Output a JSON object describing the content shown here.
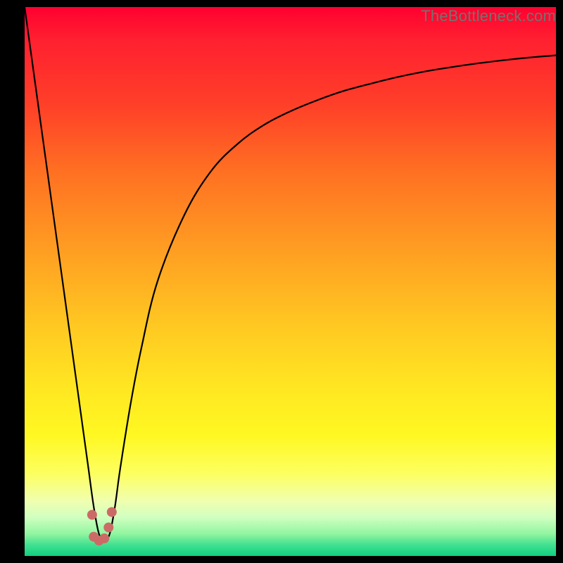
{
  "watermark": "TheBottleneck.com",
  "colors": {
    "curve": "#000000",
    "marker": "#cc6b66",
    "top_gradient": "#ff0030",
    "bottom_gradient": "#10d080"
  },
  "chart_data": {
    "type": "line",
    "title": "",
    "xlabel": "",
    "ylabel": "",
    "xlim": [
      0,
      100
    ],
    "ylim": [
      0,
      100
    ],
    "grid": false,
    "note": "x is normalized horizontal position (0–100 across plot width); y is bottleneck severity where 100=top (red, worst) and 0=bottom (green, best). Curve reaches its minimum near x≈14.",
    "series": [
      {
        "name": "bottleneck-curve",
        "x": [
          0,
          2,
          4,
          6,
          8,
          10,
          11,
          12,
          13,
          14,
          15,
          16,
          17,
          18,
          20,
          22,
          25,
          30,
          35,
          40,
          45,
          50,
          55,
          60,
          65,
          70,
          75,
          80,
          85,
          90,
          95,
          100
        ],
        "y": [
          100,
          86,
          72,
          58,
          44,
          30,
          23,
          16,
          9,
          4,
          3,
          4,
          9,
          16,
          28,
          38,
          50,
          62,
          70,
          75,
          78.5,
          81,
          83,
          84.7,
          86,
          87.2,
          88.2,
          89,
          89.7,
          90.3,
          90.8,
          91.2
        ]
      }
    ],
    "markers": {
      "name": "min-region-markers",
      "color": "#cc6b66",
      "points": [
        {
          "x": 12.7,
          "y": 7.5
        },
        {
          "x": 13.0,
          "y": 3.5
        },
        {
          "x": 14.0,
          "y": 2.8
        },
        {
          "x": 15.0,
          "y": 3.2
        },
        {
          "x": 15.8,
          "y": 5.2
        },
        {
          "x": 16.4,
          "y": 8.0
        }
      ]
    }
  }
}
